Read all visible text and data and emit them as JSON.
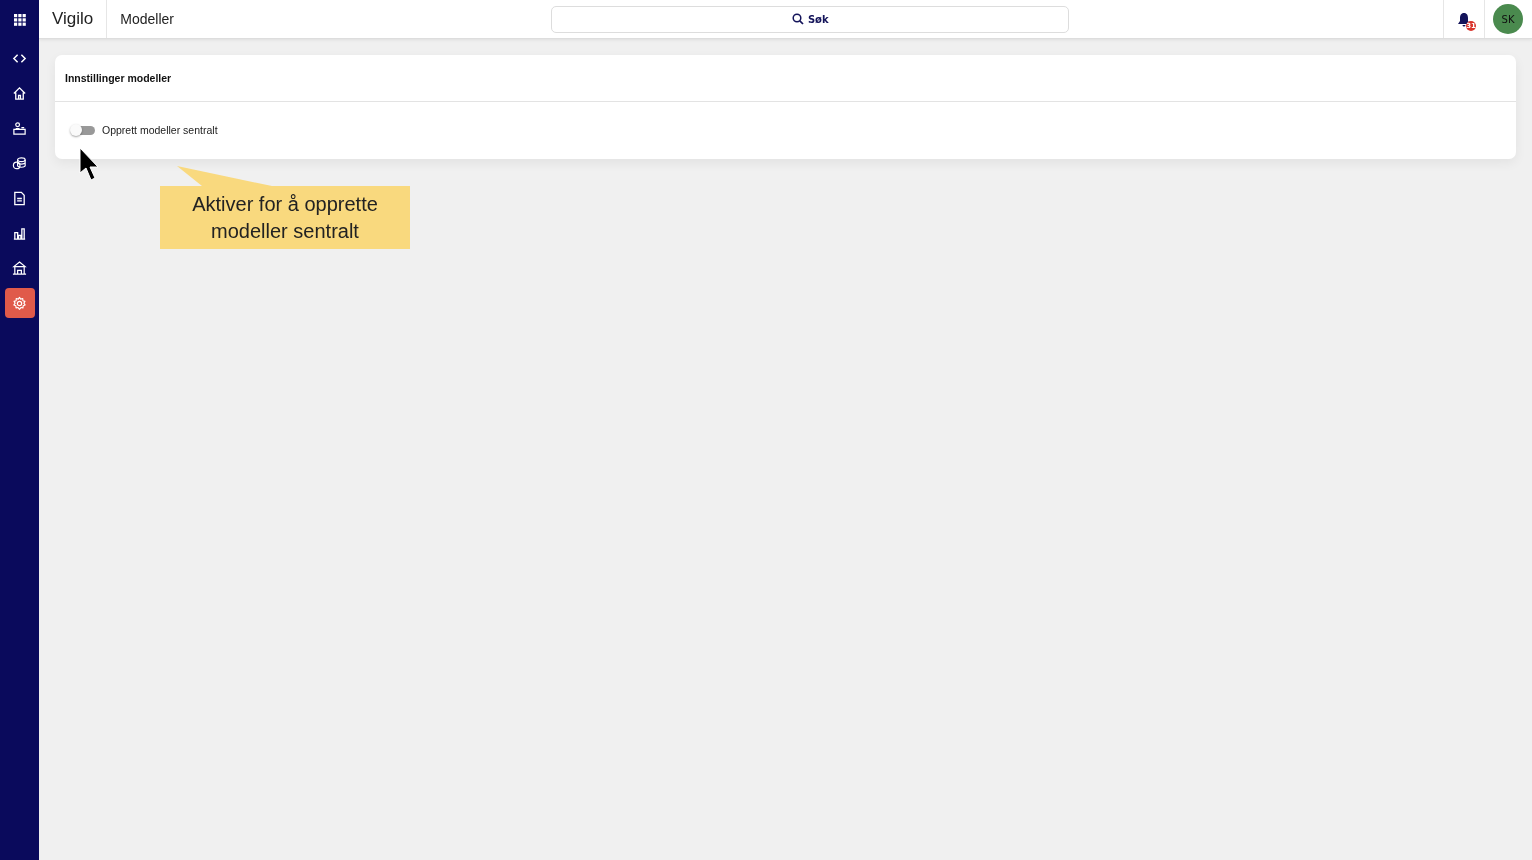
{
  "app": {
    "name": "Vigilo",
    "page_title": "Modeller"
  },
  "search": {
    "placeholder": "Søk"
  },
  "notifications": {
    "count": "31"
  },
  "user": {
    "initials": "SK"
  },
  "sidebar": {
    "items": [
      {
        "kind": "code",
        "selected": false
      },
      {
        "kind": "home",
        "selected": false
      },
      {
        "kind": "desk",
        "selected": false
      },
      {
        "kind": "coins",
        "selected": false
      },
      {
        "kind": "document",
        "selected": false
      },
      {
        "kind": "chart",
        "selected": false
      },
      {
        "kind": "building",
        "selected": false
      },
      {
        "kind": "gear",
        "selected": true
      }
    ]
  },
  "card": {
    "title": "Innstillinger modeller",
    "settings": [
      {
        "label": "Opprett modeller sentralt",
        "on": false
      }
    ]
  },
  "callout": {
    "text": "Aktiver for å opprette modeller sentralt"
  }
}
